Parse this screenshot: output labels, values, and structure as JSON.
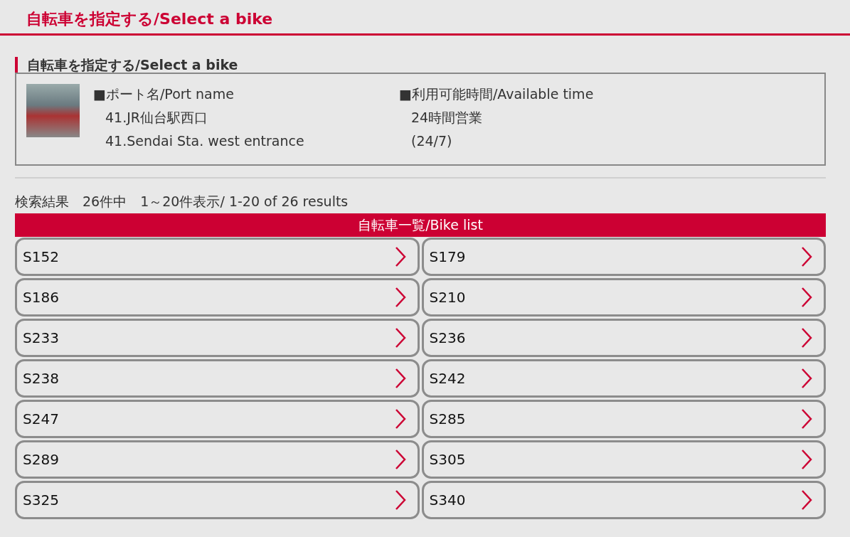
{
  "page_title": "自転車を指定する/Select a bike",
  "section": {
    "heading": "自転車を指定する/Select a bike",
    "port": {
      "label": "■ポート名/Port name",
      "lines": [
        "41.JR仙台駅西口",
        "41.Sendai Sta. west entrance"
      ]
    },
    "hours": {
      "label": "■利用可能時間/Available time",
      "lines": [
        "24時間営業",
        "(24/7)"
      ]
    }
  },
  "results_summary": "検索結果　26件中　1～20件表示/ 1-20 of 26 results",
  "list_title": "自転車一覧/Bike list",
  "bikes": [
    {
      "label": "S152"
    },
    {
      "label": "S179"
    },
    {
      "label": "S186"
    },
    {
      "label": "S210"
    },
    {
      "label": "S233"
    },
    {
      "label": "S236"
    },
    {
      "label": "S238"
    },
    {
      "label": "S242"
    },
    {
      "label": "S247"
    },
    {
      "label": "S285"
    },
    {
      "label": "S289"
    },
    {
      "label": "S305"
    },
    {
      "label": "S325"
    },
    {
      "label": "S340"
    }
  ]
}
